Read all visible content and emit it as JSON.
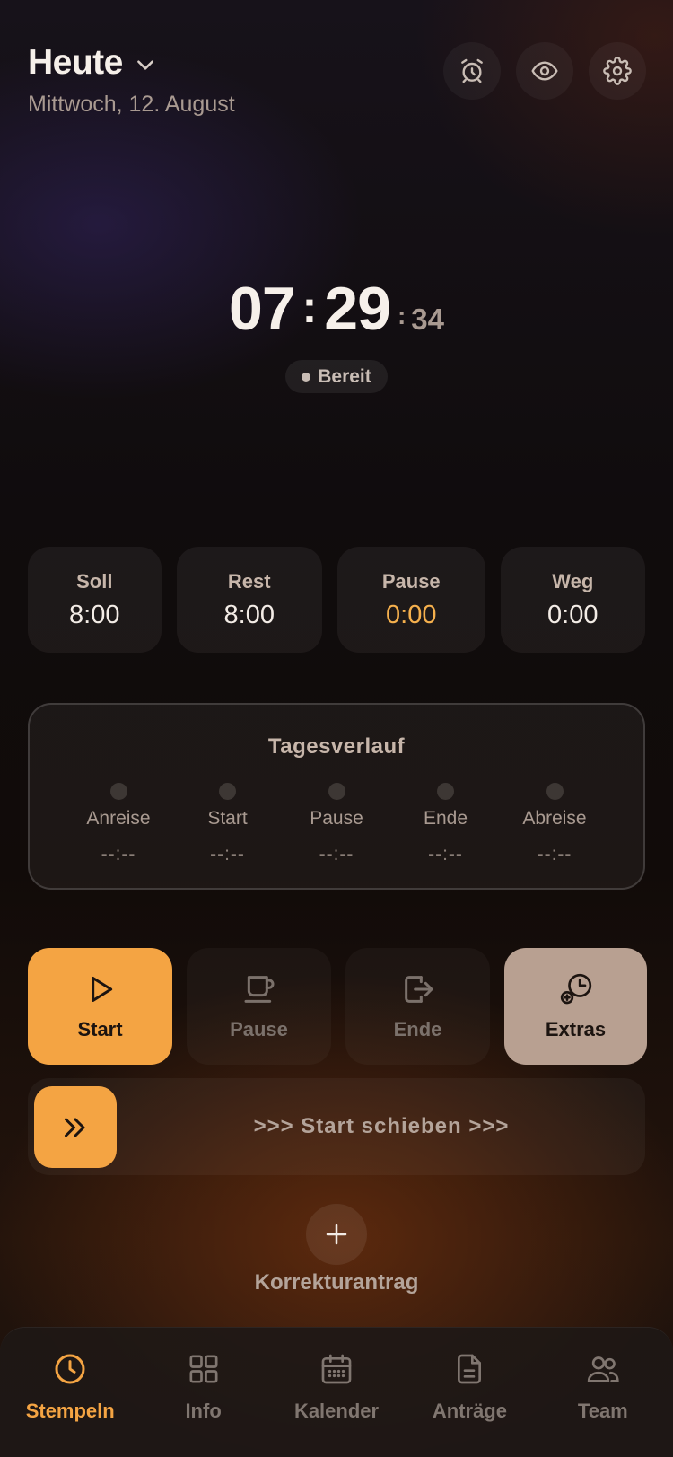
{
  "header": {
    "title": "Heute",
    "date": "Mittwoch, 12. August"
  },
  "top_icons": [
    "alarm-clock-icon",
    "eye-icon",
    "gear-icon"
  ],
  "clock": {
    "hours": "07",
    "minutes": "29",
    "seconds": "34",
    "status": "Bereit"
  },
  "stats": [
    {
      "label": "Soll",
      "value": "8:00"
    },
    {
      "label": "Rest",
      "value": "8:00"
    },
    {
      "label": "Pause",
      "value": "0:00"
    },
    {
      "label": "Weg",
      "value": "0:00"
    }
  ],
  "timeline": {
    "title": "Tagesverlauf",
    "items": [
      {
        "label": "Anreise",
        "time": "--:--"
      },
      {
        "label": "Start",
        "time": "--:--"
      },
      {
        "label": "Pause",
        "time": "--:--"
      },
      {
        "label": "Ende",
        "time": "--:--"
      },
      {
        "label": "Abreise",
        "time": "--:--"
      }
    ]
  },
  "actions": {
    "start": "Start",
    "pause": "Pause",
    "ende": "Ende",
    "extras": "Extras"
  },
  "slider": {
    "label": ">>> Start schieben >>>"
  },
  "correction": {
    "label": "Korrekturantrag"
  },
  "nav": {
    "items": [
      {
        "label": "Stempeln",
        "icon": "clock-icon"
      },
      {
        "label": "Info",
        "icon": "grid-icon"
      },
      {
        "label": "Kalender",
        "icon": "calendar-icon"
      },
      {
        "label": "Anträge",
        "icon": "document-icon"
      },
      {
        "label": "Team",
        "icon": "team-icon"
      }
    ]
  },
  "colors": {
    "accent": "#f4a443",
    "extras": "#b8a091",
    "pause_value": "#f5b04d"
  }
}
